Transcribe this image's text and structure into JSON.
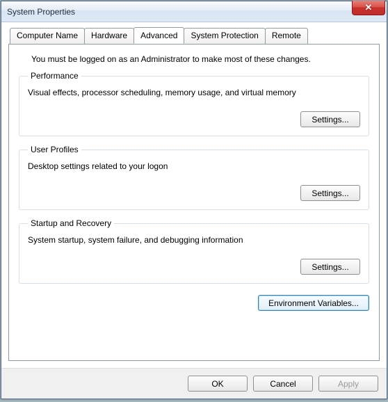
{
  "window": {
    "title": "System Properties",
    "close_label": "✕"
  },
  "tabs": {
    "computer_name": "Computer Name",
    "hardware": "Hardware",
    "advanced": "Advanced",
    "system_protection": "System Protection",
    "remote": "Remote"
  },
  "advanced": {
    "intro": "You must be logged on as an Administrator to make most of these changes.",
    "performance": {
      "legend": "Performance",
      "desc": "Visual effects, processor scheduling, memory usage, and virtual memory",
      "button": "Settings..."
    },
    "user_profiles": {
      "legend": "User Profiles",
      "desc": "Desktop settings related to your logon",
      "button": "Settings..."
    },
    "startup_recovery": {
      "legend": "Startup and Recovery",
      "desc": "System startup, system failure, and debugging information",
      "button": "Settings..."
    },
    "env_button": "Environment Variables..."
  },
  "buttons": {
    "ok": "OK",
    "cancel": "Cancel",
    "apply": "Apply"
  }
}
